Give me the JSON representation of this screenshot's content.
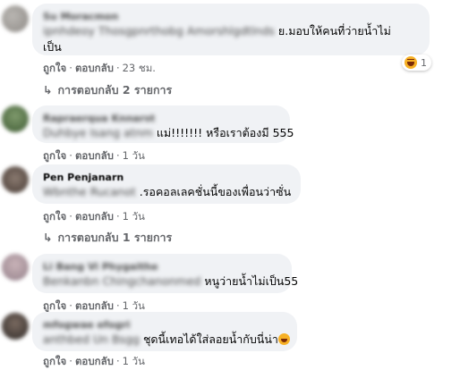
{
  "comments": [
    {
      "name": "Su Moracmon",
      "blurred_prefix": "ipnhdeoy Thosgpnrthobg Amorshlgdtlnds",
      "text_line1": "ย.มอบให้คนที่ว่ายน้ำไม่",
      "text_line2": "เป็น",
      "like": "ถูกใจ",
      "reply": "ตอบกลับ",
      "time": "23 ชม.",
      "reaction_count": "1",
      "replies_label": "การตอบกลับ 2 รายการ"
    },
    {
      "name": "Rapraerqua Knnarst",
      "blurred_prefix": "Duhbye Isang atnm",
      "text": "แม่!!!!!!! หรือเราต้องมี 555",
      "like": "ถูกใจ",
      "reply": "ตอบกลับ",
      "time": "1 วัน"
    },
    {
      "name": "Pen Penjanarn",
      "blurred_prefix": "Wbnthe Rucanot",
      "text": ".รอคอลเลคชั่นนี้ของเพื่อนว่าซั่น",
      "like": "ถูกใจ",
      "reply": "ตอบกลับ",
      "time": "1 วัน",
      "replies_label": "การตอบกลับ 1 รายการ"
    },
    {
      "name": "Li Bang Vi Phygaithe",
      "blurred_prefix": "Benkanbn Chingchanonmed",
      "text": "หนูว่ายน้ำไม่เป็น55",
      "like": "ถูกใจ",
      "reply": "ตอบกลับ",
      "time": "1 วัน"
    },
    {
      "name": "mfogwae efogri",
      "blurred_prefix": "anthbed Un Bsgg",
      "text": "ชุดนี้เทอได้ใส่ลอยน้ำกับนี่น่า",
      "like": "ถูกใจ",
      "reply": "ตอบกลับ",
      "time": "1 วัน"
    }
  ],
  "colors": {
    "bubble": "#f0f2f5",
    "meta": "#65676b",
    "text": "#050505",
    "haha": "#f7b125"
  },
  "icons": {
    "reaction": "haha-icon",
    "reply_arrow": "reply-arrow-icon",
    "inline_emoji": "laughing-emoji-icon"
  }
}
